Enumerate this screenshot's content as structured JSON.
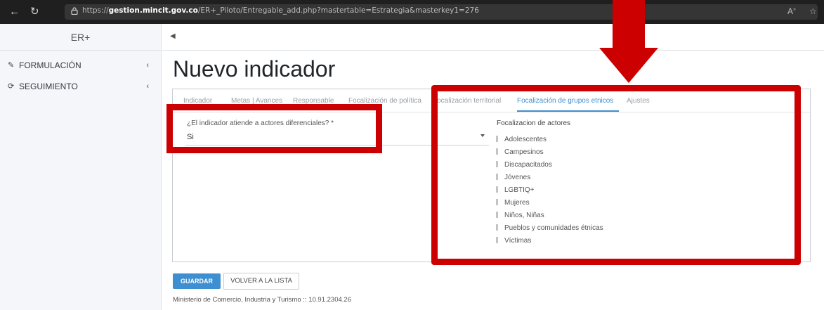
{
  "browser": {
    "url_prefix": "https://",
    "url_host": "gestion.mincit.gov.co",
    "url_path": "/ER+_Piloto/Entregable_add.php?mastertable=Estrategia&masterkey1=276"
  },
  "sidebar": {
    "brand": "ER+",
    "items": [
      {
        "label": "FORMULACIÓN"
      },
      {
        "label": "SEGUIMIENTO"
      }
    ]
  },
  "page": {
    "title": "Nuevo indicador"
  },
  "tabs": [
    {
      "label": "Indicador"
    },
    {
      "label": "Metas | Avances"
    },
    {
      "label": "Responsable"
    },
    {
      "label": "Focalización de política"
    },
    {
      "label": "Focalización territorial"
    },
    {
      "label": "Focalización de grupos etnicos"
    },
    {
      "label": "Ajustes"
    }
  ],
  "form": {
    "differential_label": "¿El indicador atiende a actores diferenciales? *",
    "differential_value": "Si",
    "actors_title": "Focalizacion de actores",
    "actors": [
      "Adolescentes",
      "Campesinos",
      "Discapacitados",
      "Jóvenes",
      "LGBTIQ+",
      "Mujeres",
      "Niños, Niñas",
      "Pueblos y comunidades étnicas",
      "Víctimas"
    ]
  },
  "buttons": {
    "save": "GUARDAR",
    "back": "VOLVER A LA LISTA"
  },
  "footer": {
    "text": "Ministerio de Comercio, Industria y Turismo :: 10.91.2304.26"
  },
  "colors": {
    "accent": "#3d8fd1",
    "highlight": "#cc0000"
  }
}
